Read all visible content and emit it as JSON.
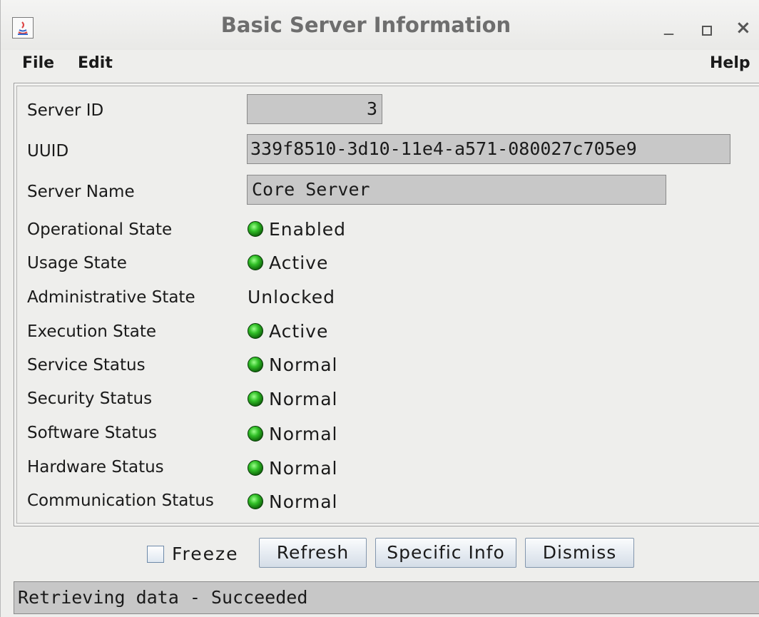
{
  "window": {
    "title": "Basic Server Information",
    "minimize_glyph": "_",
    "close_glyph": "×"
  },
  "menubar": {
    "file": "File",
    "edit": "Edit",
    "help": "Help"
  },
  "info": {
    "server_id": {
      "label": "Server ID",
      "value": "3"
    },
    "uuid": {
      "label": "UUID",
      "value": "339f8510-3d10-11e4-a571-080027c705e9"
    },
    "server_name": {
      "label": "Server Name",
      "value": "Core Server"
    },
    "operational_state": {
      "label": "Operational State",
      "value": "Enabled",
      "indicator": "green"
    },
    "usage_state": {
      "label": "Usage State",
      "value": "Active",
      "indicator": "green"
    },
    "administrative_state": {
      "label": "Administrative State",
      "value": "Unlocked"
    },
    "execution_state": {
      "label": "Execution State",
      "value": "Active",
      "indicator": "green"
    },
    "service_status": {
      "label": "Service Status",
      "value": "Normal",
      "indicator": "green"
    },
    "security_status": {
      "label": "Security Status",
      "value": "Normal",
      "indicator": "green"
    },
    "software_status": {
      "label": "Software Status",
      "value": "Normal",
      "indicator": "green"
    },
    "hardware_status": {
      "label": "Hardware Status",
      "value": "Normal",
      "indicator": "green"
    },
    "communication_status": {
      "label": "Communication Status",
      "value": "Normal",
      "indicator": "green"
    }
  },
  "controls": {
    "freeze_label": "Freeze",
    "freeze_checked": false,
    "refresh_label": "Refresh",
    "specific_info_label": "Specific Info",
    "dismiss_label": "Dismiss"
  },
  "statusbar": {
    "text": "Retrieving data - Succeeded"
  },
  "colors": {
    "indicator_green": "#32c028",
    "field_background": "#c8c8c8",
    "window_background": "#eeeeec"
  }
}
